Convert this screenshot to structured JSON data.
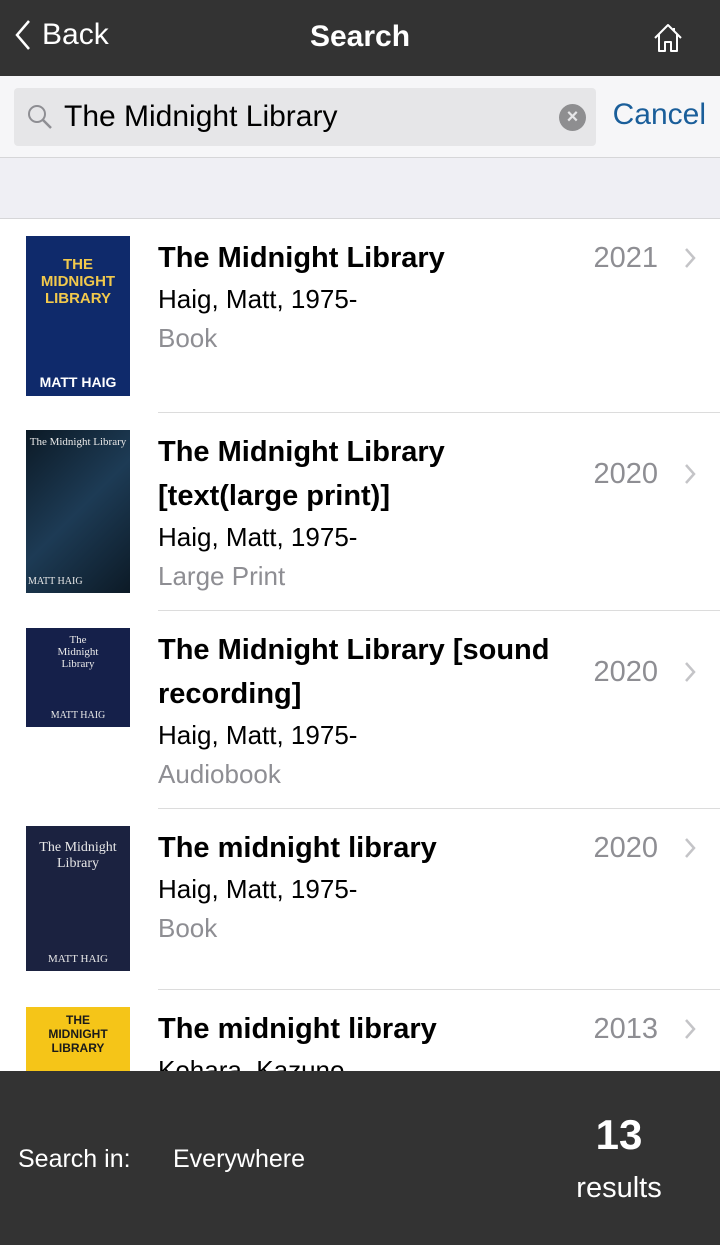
{
  "nav": {
    "back_label": "Back",
    "title": "Search",
    "home_icon": "home-icon"
  },
  "search": {
    "value": "The Midnight Library",
    "cancel_label": "Cancel"
  },
  "results": [
    {
      "title": "The Midnight Library",
      "author": "Haig, Matt, 1975-",
      "type": "Book",
      "year": "2021",
      "cover": {
        "bg": "#0f2a6b",
        "fg": "#f2c94c",
        "top": "THE MIDNIGHT LIBRARY",
        "bottom": "MATT HAIG"
      }
    },
    {
      "title": "The Midnight Library [text(large print)]",
      "author": "Haig, Matt, 1975-",
      "type": "Large Print",
      "year": "2020",
      "cover": {
        "bg": "#0c1a26",
        "fg": "#e8e8e8",
        "top": "The Midnight Library",
        "bottom": "MATT HAIG"
      }
    },
    {
      "title": "The Midnight Library [sound recording]",
      "author": "Haig, Matt, 1975-",
      "type": "Audiobook",
      "year": "2020",
      "cover": {
        "bg": "#15204a",
        "fg": "#e8e8e8",
        "top": "The Midnight Library",
        "bottom": "MATT HAIG"
      }
    },
    {
      "title": "The midnight library",
      "author": "Haig, Matt, 1975-",
      "type": "Book",
      "year": "2020",
      "cover": {
        "bg": "#1b2240",
        "fg": "#e8e8e8",
        "top": "The Midnight Library",
        "bottom": "MATT HAIG"
      }
    },
    {
      "title": "The midnight library",
      "author": "Kohara, Kazuno",
      "type": "",
      "year": "2013",
      "cover": {
        "bg": "#f5c518",
        "fg": "#1a1a1a",
        "top": "THE MIDNIGHT LIBRARY",
        "bottom": ""
      }
    }
  ],
  "footer": {
    "search_in_label": "Search in:",
    "scope": "Everywhere",
    "count": "13",
    "count_label": "results"
  }
}
